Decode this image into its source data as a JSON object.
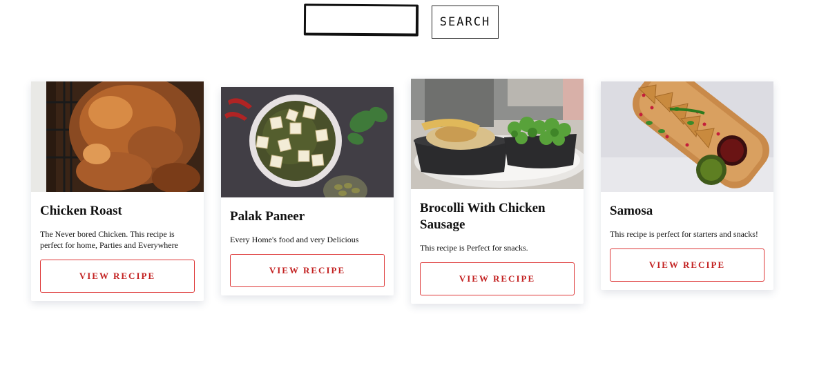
{
  "search": {
    "value": "",
    "placeholder": "",
    "button_label": "SEARCH"
  },
  "recipes": [
    {
      "title": "Chicken Roast",
      "description": "The Never bored Chicken. This recipe is perfect for home, Parties and Everywhere",
      "button_label": "VIEW RECIPE"
    },
    {
      "title": "Palak Paneer",
      "description": "Every Home's food and very Delicious",
      "button_label": "VIEW RECIPE"
    },
    {
      "title": "Brocolli With Chicken Sausage",
      "description": "This recipe is Perfect for snacks.",
      "button_label": "VIEW RECIPE"
    },
    {
      "title": "Samosa",
      "description": "This recipe is perfect for starters and snacks!",
      "button_label": "VIEW RECIPE"
    }
  ],
  "colors": {
    "accent": "#c32222",
    "card_shadow": "#dfe6ef"
  }
}
